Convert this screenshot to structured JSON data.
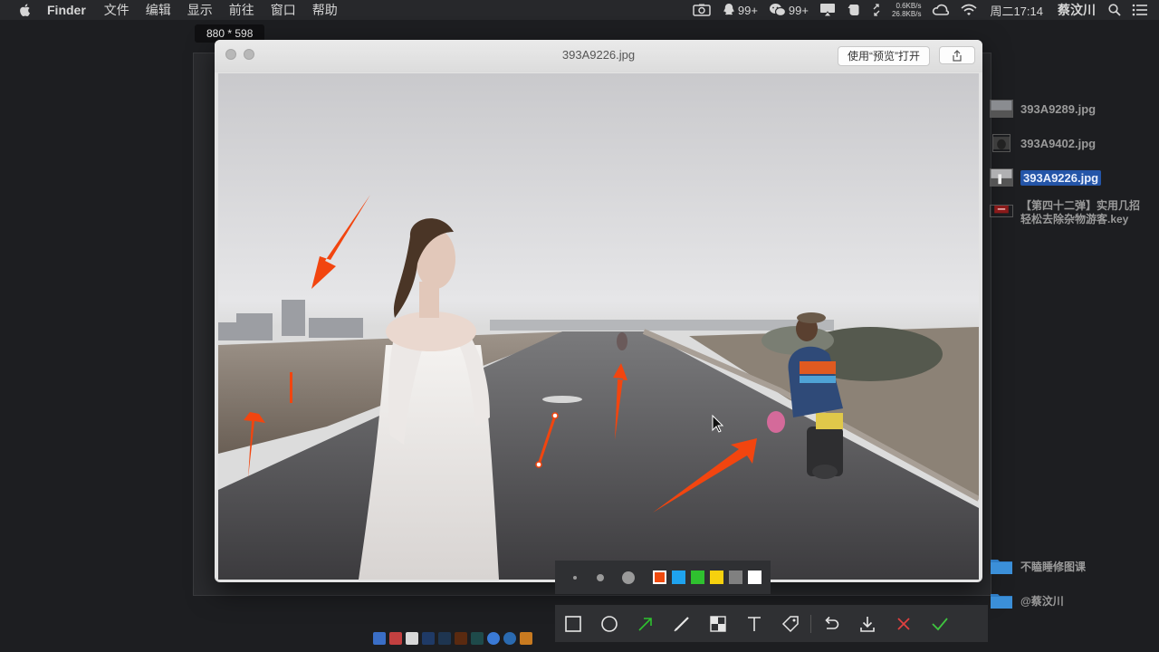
{
  "menubar": {
    "app_name": "Finder",
    "menus": [
      "文件",
      "编辑",
      "显示",
      "前往",
      "窗口",
      "帮助"
    ],
    "qq_count": "99+",
    "wechat_count": "99+",
    "net_up": "0.6KB/s",
    "net_down": "26.8KB/s",
    "clock": "周二17:14",
    "user": "蔡汶川"
  },
  "size_tooltip": "880 * 598",
  "quicklook": {
    "title": "393A9226.jpg",
    "open_button": "使用“预览”打开"
  },
  "desktop": {
    "files": [
      {
        "name": "393A9289.jpg",
        "selected": false
      },
      {
        "name": "393A9402.jpg",
        "selected": false
      },
      {
        "name": "393A9226.jpg",
        "selected": true
      }
    ],
    "keynote": {
      "line1": "【第四十二弹】实用几招",
      "line2": "轻松去除杂物游客.key"
    },
    "folders": [
      {
        "name": "不瞌睡修图课"
      },
      {
        "name": "@蔡汶川"
      }
    ]
  },
  "colors": {
    "swatches": [
      "#f04a0e",
      "#1fa3ef",
      "#2fc12f",
      "#f6d10e",
      "#808080",
      "#ffffff"
    ],
    "arrow": "#f2450f",
    "selection": "#2455a8"
  },
  "icons": {
    "tools": [
      "rectangle-icon",
      "ellipse-icon",
      "arrow-icon",
      "pen-icon",
      "mosaic-icon",
      "text-icon",
      "tag-icon",
      "undo-icon",
      "download-icon",
      "cancel-icon",
      "confirm-icon"
    ]
  }
}
